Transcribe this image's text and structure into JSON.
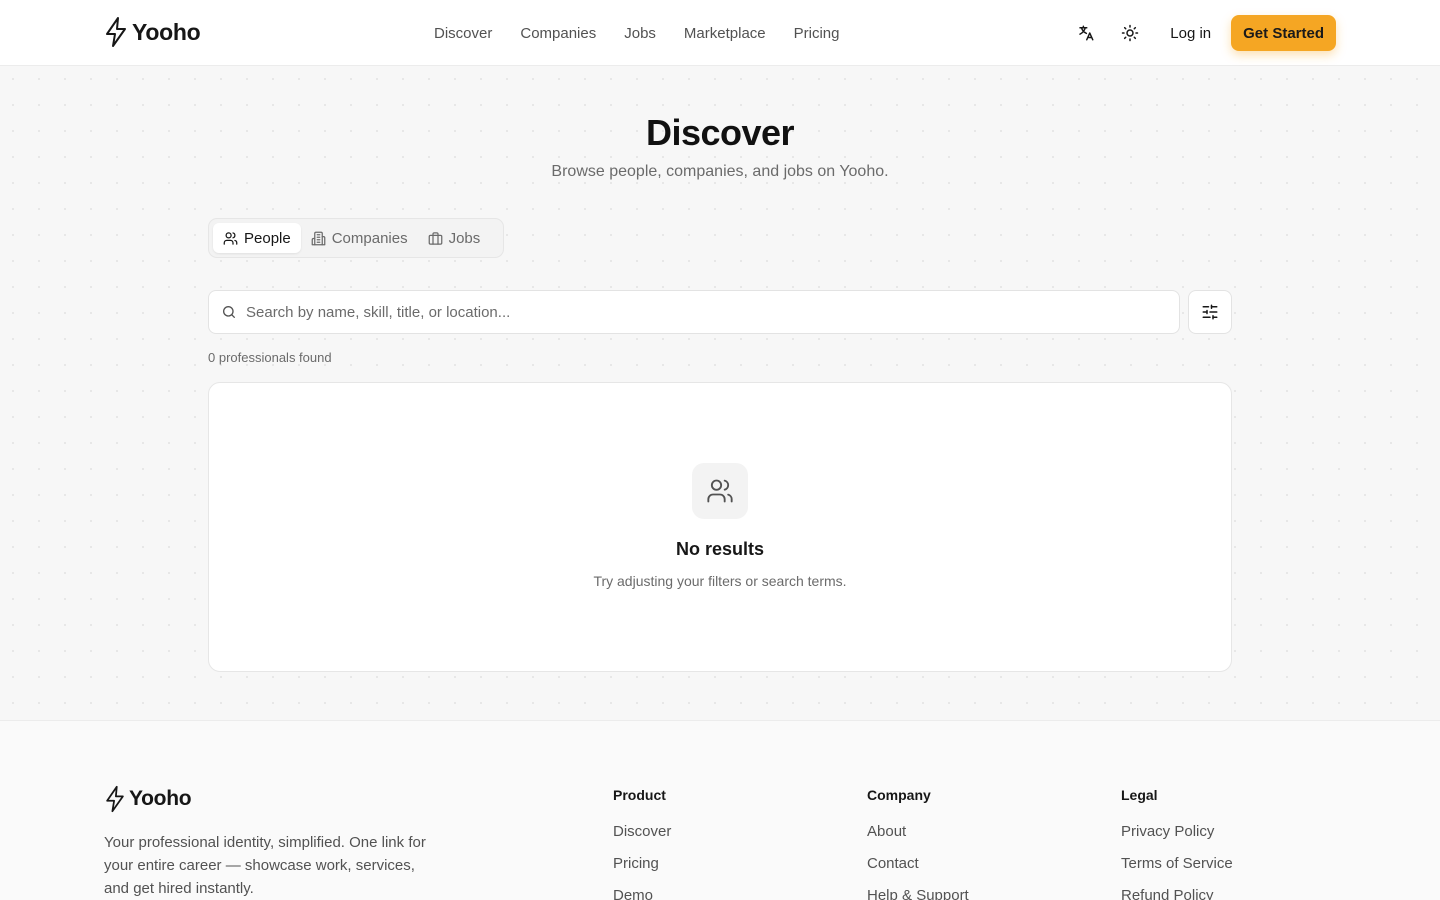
{
  "header": {
    "brand": "Yooho",
    "nav": [
      "Discover",
      "Companies",
      "Jobs",
      "Marketplace",
      "Pricing"
    ],
    "login_label": "Log in",
    "cta_label": "Get Started"
  },
  "hero": {
    "title": "Discover",
    "subtitle": "Browse people, companies, and jobs on Yooho."
  },
  "tabs": [
    {
      "label": "People",
      "active": true
    },
    {
      "label": "Companies",
      "active": false
    },
    {
      "label": "Jobs",
      "active": false
    }
  ],
  "search": {
    "placeholder": "Search by name, skill, title, or location...",
    "value": ""
  },
  "results": {
    "count_text": "0 professionals found",
    "empty_title": "No results",
    "empty_text": "Try adjusting your filters or search terms."
  },
  "footer": {
    "brand": "Yooho",
    "description": "Your professional identity, simplified. One link for your entire career — showcase work, services, and get hired instantly.",
    "columns": [
      {
        "title": "Product",
        "links": [
          "Discover",
          "Pricing",
          "Demo"
        ]
      },
      {
        "title": "Company",
        "links": [
          "About",
          "Contact",
          "Help & Support"
        ]
      },
      {
        "title": "Legal",
        "links": [
          "Privacy Policy",
          "Terms of Service",
          "Refund Policy"
        ]
      }
    ]
  },
  "colors": {
    "accent": "#f5a623",
    "text": "#171717",
    "muted": "#6b6b6b",
    "background": "#f7f7f7"
  },
  "icons": [
    "bolt-logo-icon",
    "translate-icon",
    "sun-icon",
    "users-icon",
    "building-icon",
    "briefcase-icon",
    "search-icon",
    "sliders-icon"
  ]
}
